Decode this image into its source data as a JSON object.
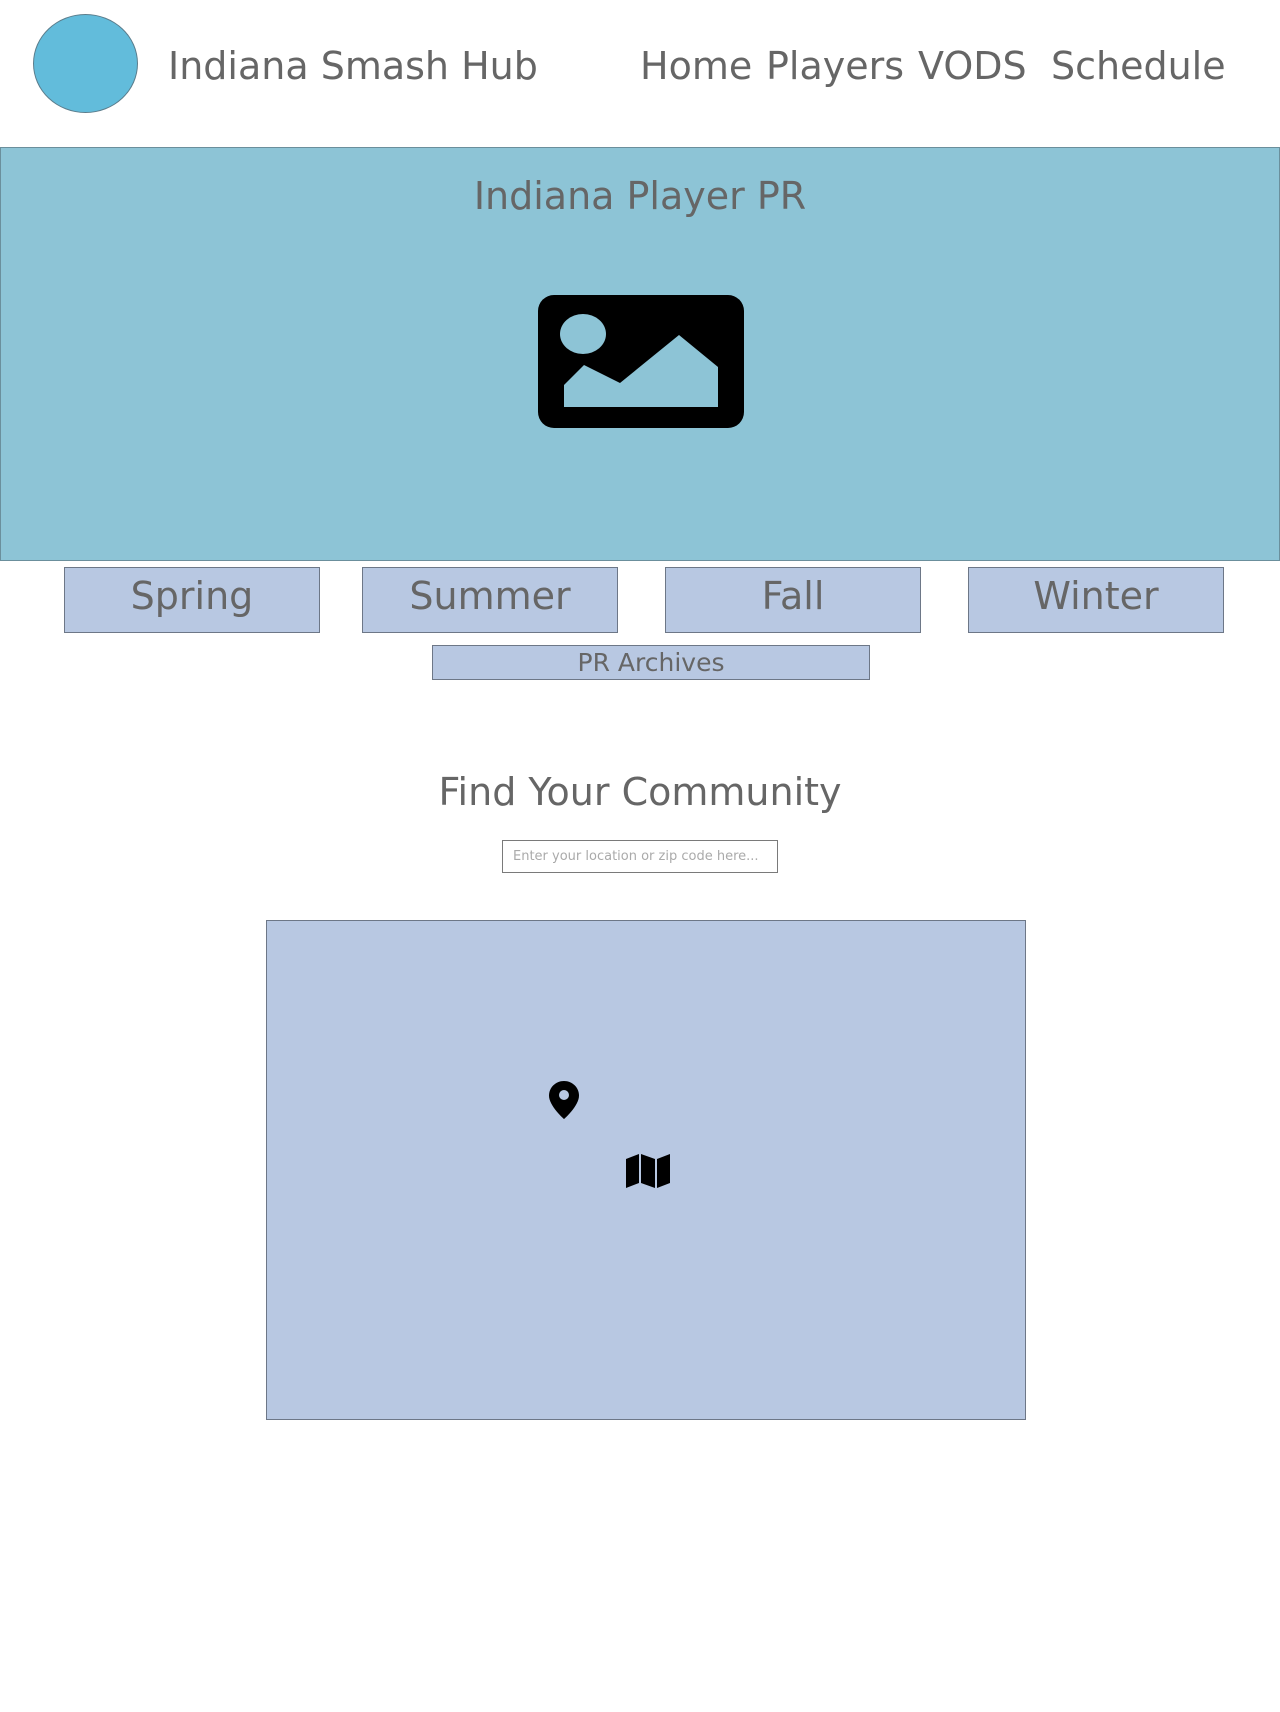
{
  "header": {
    "logo_icon": "circle-logo",
    "site_title": "Indiana Smash Hub",
    "nav": {
      "home": "Home",
      "players": "Players",
      "vods": "VODS",
      "schedule": "Schedule"
    }
  },
  "hero": {
    "title": "Indiana Player PR",
    "image_icon": "image-placeholder-icon"
  },
  "seasons": {
    "spring": "Spring",
    "summer": "Summer",
    "fall": "Fall",
    "winter": "Winter"
  },
  "archives": {
    "label": "PR Archives"
  },
  "community": {
    "title": "Find Your Community",
    "search_placeholder": "Enter your location or zip code here...",
    "map_icons": [
      "map-pin-icon",
      "map-icon"
    ]
  },
  "colors": {
    "logo": "#62bcdb",
    "hero_background": "#8dc4d6",
    "button_background": "#b8c8e2",
    "map_background": "#b8c8e2",
    "text": "#666666"
  }
}
